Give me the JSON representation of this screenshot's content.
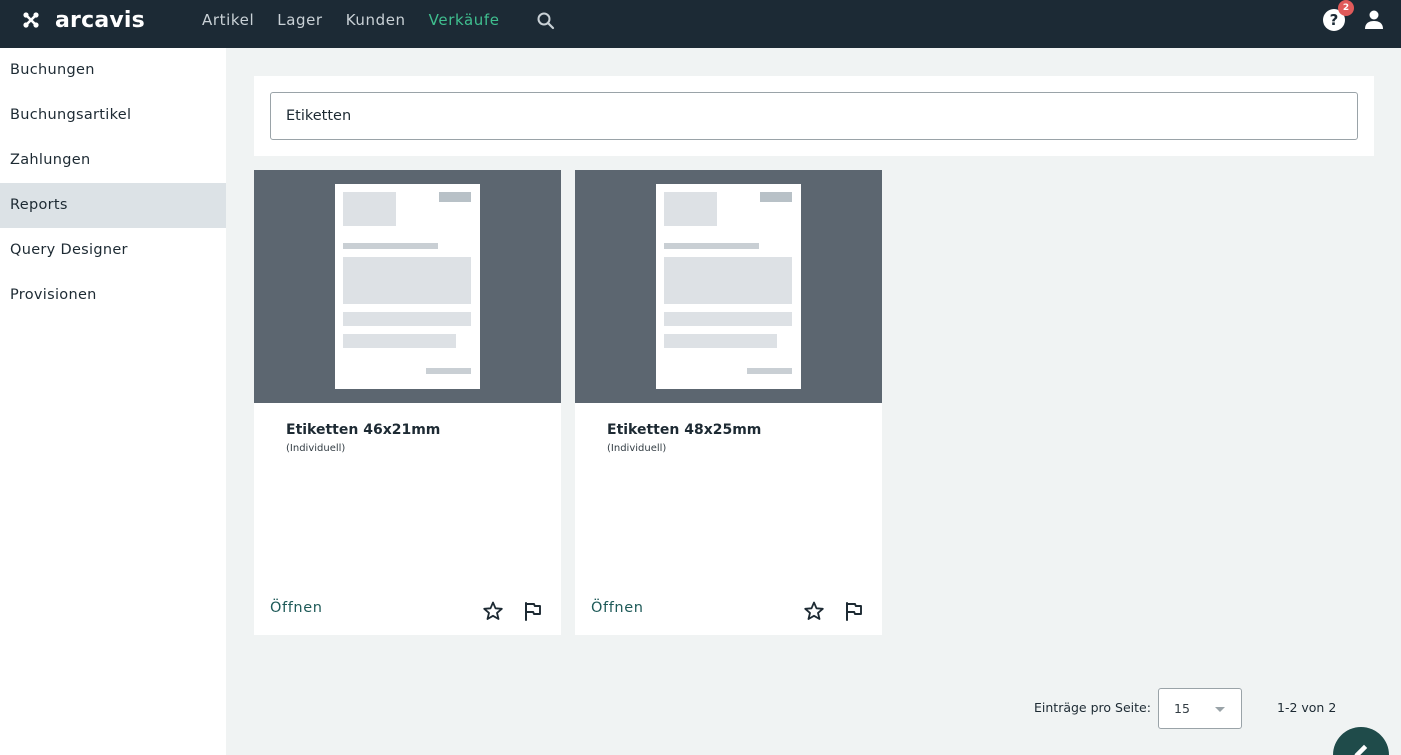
{
  "app": {
    "brand": "arcavis"
  },
  "topnav": {
    "items": [
      {
        "label": "Artikel"
      },
      {
        "label": "Lager"
      },
      {
        "label": "Kunden"
      },
      {
        "label": "Verkäufe",
        "active": true
      }
    ],
    "search_icon": "search-icon",
    "help_icon": "help-icon",
    "help_badge": "2",
    "user_icon": "user-icon",
    "accent_color": "#3fbf8f"
  },
  "sidebar": {
    "items": [
      {
        "label": "Buchungen"
      },
      {
        "label": "Buchungsartikel"
      },
      {
        "label": "Zahlungen"
      },
      {
        "label": "Reports",
        "active": true
      },
      {
        "label": "Query Designer"
      },
      {
        "label": "Provisionen"
      }
    ]
  },
  "search": {
    "value": "Etiketten"
  },
  "cards": [
    {
      "title": "Etiketten 46x21mm",
      "subtitle": "(Individuell)",
      "open_label": "Öffnen",
      "star_icon": "star-outline-icon",
      "flag_icon": "flag-outline-icon"
    },
    {
      "title": "Etiketten 48x25mm",
      "subtitle": "(Individuell)",
      "open_label": "Öffnen",
      "star_icon": "star-outline-icon",
      "flag_icon": "flag-outline-icon"
    }
  ],
  "pagination": {
    "per_page_label": "Einträge pro Seite:",
    "per_page_value": "15",
    "range_text": "1-2 von 2"
  },
  "fab": {
    "icon": "pencil-icon"
  },
  "colors": {
    "topbar": "#1c2a35",
    "thumb": "#5c6670",
    "open_link": "#1e5a58",
    "fab": "#1f4b4a",
    "badge": "#e05a5a"
  }
}
